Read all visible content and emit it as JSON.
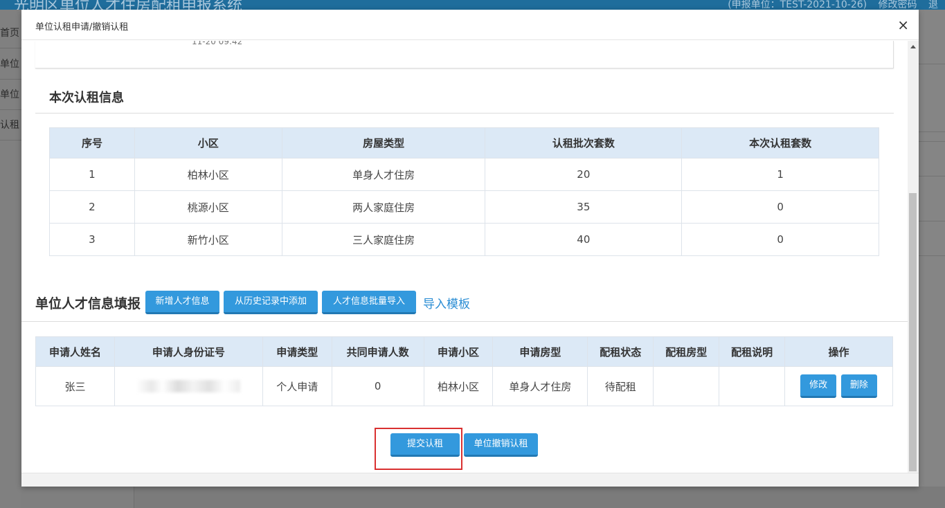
{
  "background": {
    "header_title": "光明区单位人才住房配租申报系统",
    "header_unit": "(申报单位：TEST-2021-10-26)",
    "header_change_password": "修改密码",
    "header_logout": "退",
    "sidebar_items": [
      "首页",
      "单位",
      "单位",
      "认租"
    ]
  },
  "modal": {
    "title": "单位认租申请/撤销认租",
    "close_symbol": "×",
    "prev_card_text": "11-20 09:42"
  },
  "lease_info": {
    "title": "本次认租信息",
    "columns": [
      "序号",
      "小区",
      "房屋类型",
      "认租批次套数",
      "本次认租套数"
    ],
    "rows": [
      [
        "1",
        "柏林小区",
        "单身人才住房",
        "20",
        "1"
      ],
      [
        "2",
        "桃源小区",
        "两人家庭住房",
        "35",
        "0"
      ],
      [
        "3",
        "新竹小区",
        "三人家庭住房",
        "40",
        "0"
      ]
    ]
  },
  "talent": {
    "title": "单位人才信息填报",
    "add_button": "新增人才信息",
    "history_button": "从历史记录中添加",
    "batch_import_button": "人才信息批量导入",
    "template_link": "导入模板",
    "columns": [
      "申请人姓名",
      "申请人身份证号",
      "申请类型",
      "共同申请人数",
      "申请小区",
      "申请房型",
      "配租状态",
      "配租房型",
      "配租说明",
      "操作"
    ],
    "rows": [
      {
        "name": "张三",
        "id_number": "",
        "apply_type": "个人申请",
        "co_applicants": "0",
        "community": "柏林小区",
        "room_type": "单身人才住房",
        "status": "待配租",
        "assigned_type": "",
        "note": "",
        "edit": "修改",
        "delete": "删除"
      }
    ]
  },
  "actions": {
    "submit": "提交认租",
    "cancel": "单位撤销认租"
  }
}
